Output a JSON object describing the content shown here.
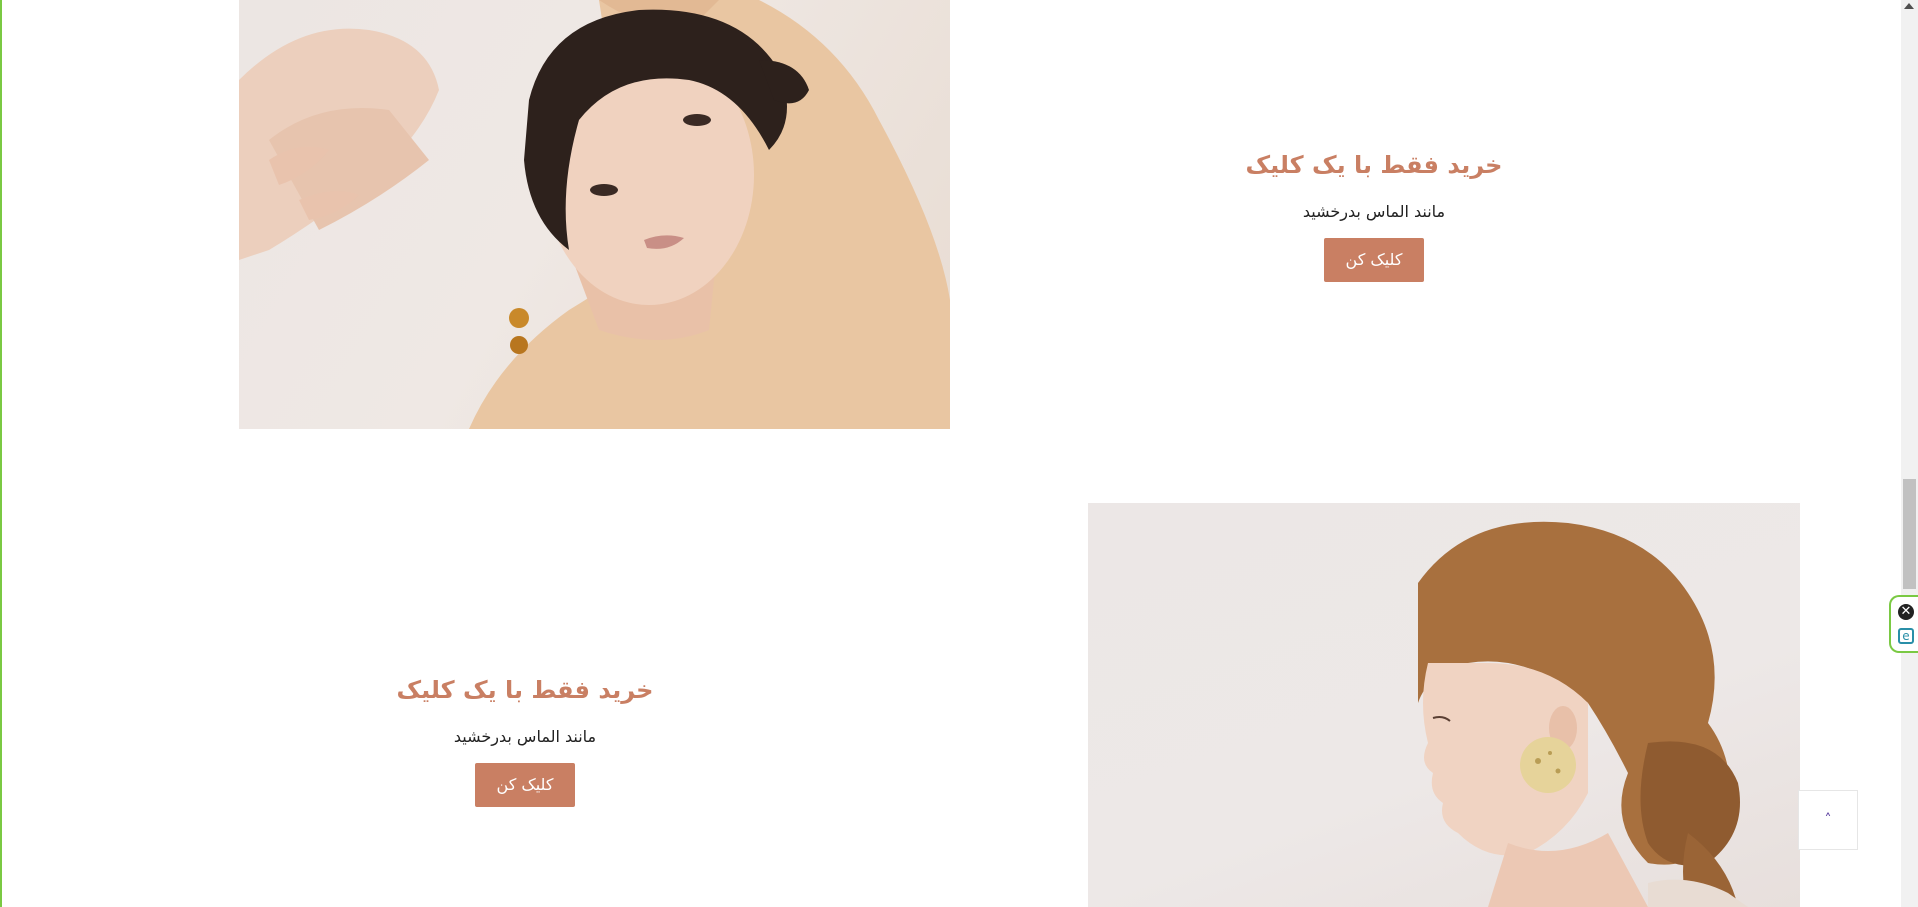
{
  "promos": [
    {
      "title": "خرید فقط با یک کلیک",
      "subtitle": "مانند الماس بدرخشید",
      "button_label": "کلیک کن"
    },
    {
      "title": "خرید فقط با یک کلیک",
      "subtitle": "مانند الماس بدرخشید",
      "button_label": "کلیک کن"
    }
  ],
  "widget": {
    "close_glyph": "✕",
    "e_glyph": "e"
  },
  "back_to_top": {
    "glyph": "˄"
  },
  "colors": {
    "accent": "#c97f63",
    "left_accent": "#7ac943",
    "widget_blue": "#2a8fa8"
  }
}
